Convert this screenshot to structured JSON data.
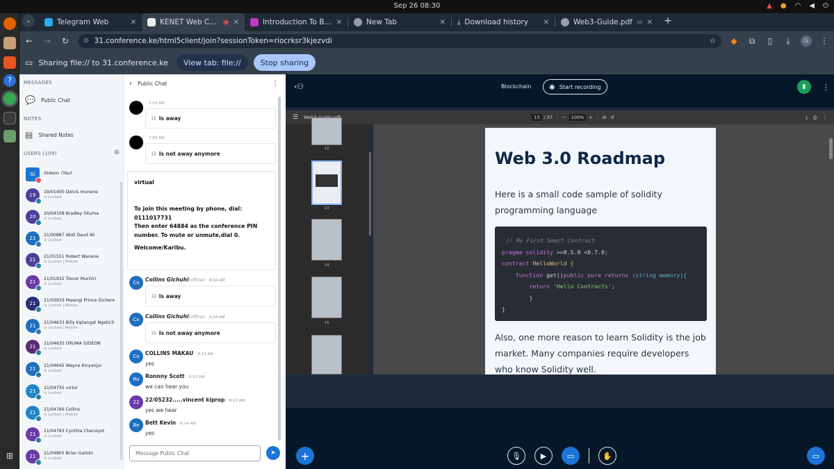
{
  "system": {
    "clock": "Sep 26  08:30"
  },
  "tabs": [
    {
      "label": "Telegram Web",
      "color": "#2aabee"
    },
    {
      "label": "KENET Web Conferenc",
      "color": "#eeeeee",
      "active": true
    },
    {
      "label": "Introduction To Blockcha",
      "color": "#c23bbd"
    },
    {
      "label": "New Tab",
      "color": "#9aa0a6"
    },
    {
      "label": "Download history",
      "color": "#9aa0a6"
    },
    {
      "label": "Web3-Guide.pdf",
      "color": "#9aa0a6"
    }
  ],
  "address": {
    "url": "31.conference.ke/html5client/join?sessionToken=riocrksr3kjezvdi"
  },
  "sharebar": {
    "text": "Sharing file:// to 31.conference.ke",
    "view_tab": "View tab: file://",
    "stop": "Stop sharing"
  },
  "sidebar": {
    "messages_head": "MESSAGES",
    "public_chat": "Public Chat",
    "notes_head": "NOTES",
    "shared_notes": "Shared Notes",
    "users_head": "USERS (109)",
    "users": [
      {
        "initials": "Gi",
        "name": "Gideon",
        "you": "(You)",
        "sub": "",
        "color": "#1b74d6"
      },
      {
        "initials": "19",
        "name": "19/01400 Delvis munene",
        "sub": "Locked",
        "color": "#4b3f9a"
      },
      {
        "initials": "20",
        "name": "20/04108 Bradley Situma",
        "sub": "Locked",
        "color": "#4b3f9a"
      },
      {
        "initials": "21",
        "name": "21/00887 Abdi Daud Ali",
        "sub": "Locked",
        "color": "#1f6fc0"
      },
      {
        "initials": "21",
        "name": "21/01551 Robert Wanene",
        "sub": "Locked | Mobile",
        "color": "#4b3f9a"
      },
      {
        "initials": "21",
        "name": "21/01932 Trevor Muchiri",
        "sub": "Locked",
        "color": "#6a3aa8"
      },
      {
        "initials": "21",
        "name": "21/03933 Mwangi Prince Gichere",
        "sub": "Locked | Mobile",
        "color": "#2a2f7a"
      },
      {
        "initials": "21",
        "name": "21/04633 Billy kiplangat Ngetich",
        "sub": "Locked | Mobile",
        "color": "#1f6fc0"
      },
      {
        "initials": "21",
        "name": "21/04635 ORUMA GIDEON",
        "sub": "Locked",
        "color": "#5b2a7a"
      },
      {
        "initials": "21",
        "name": "21/04645 Wayne Kinyanjui",
        "sub": "Locked",
        "color": "#1f6fc0"
      },
      {
        "initials": "21",
        "name": "21/04735 victor",
        "sub": "Locked",
        "color": "#1f86c8"
      },
      {
        "initials": "21",
        "name": "21/04766 Collins",
        "sub": "Locked | Mobile",
        "color": "#1f86c8"
      },
      {
        "initials": "21",
        "name": "21/04783 Cynthia Cheruiyot",
        "sub": "Locked",
        "color": "#6a3aa8"
      },
      {
        "initials": "21",
        "name": "21/04805 Brian Gatoto",
        "sub": "Locked",
        "color": "#6a3aa8"
      }
    ]
  },
  "chat": {
    "title": "Public Chat",
    "m1_time": "7:55 AM",
    "m1_text": "Is away",
    "m2_time": "7:55 AM",
    "m2_text": "Is not away anymore",
    "welcome": {
      "l1": "virtual",
      "l2": "To join this meeting by phone, dial:",
      "l3": "0111017731",
      "l4": "Then enter 64884 as the conference PIN number. To mute or unmute,dial 0.",
      "l5": "Welcome/Karibu."
    },
    "m3_name": "Collins Gichuhi",
    "m3_offline": "(offline)",
    "m3_time": "8:04 AM",
    "m3_text": "Is away",
    "m4_name": "Collins Gichuhi",
    "m4_offline": "(offline)",
    "m4_time": "8:04 AM",
    "m4_text": "Is not away anymore",
    "m5_name": "COLLINS MAKAU",
    "m5_time": "8:13 AM",
    "m5_text": "yes",
    "m6_name": "Ronnny Scott",
    "m6_time": "8:13 AM",
    "m6_text": "we can hear you",
    "m7_name": "22/05232.....vincent kiprop",
    "m7_time": "8:13 AM",
    "m7_text": "yes we hear",
    "m8_name": "Bett Kevin",
    "m8_time": "8:14 AM",
    "m8_text": "yes",
    "av_co": "Co",
    "av_ro": "Ro",
    "av_22": "22",
    "av_be": "Be",
    "placeholder": "Message Public Chat"
  },
  "meeting": {
    "title": "Blockchain",
    "record": "Start recording"
  },
  "pdf": {
    "name": "Web3-Guide.pdf",
    "page": "13",
    "pages": "/ 37",
    "zoom": "100%",
    "thumbs": [
      "12",
      "13",
      "14",
      "15"
    ]
  },
  "doc": {
    "heading": "Web 3.0 Roadmap",
    "intro": "Here is a small code sample of solidity programming language",
    "code": {
      "c1": "// My First Smart Contract",
      "c2a": "pragma solidity",
      "c2b": " >=0.5.0 <0.7.0;",
      "c3a": "contract",
      "c3b": " HelloWorld",
      "c3c": " {",
      "c4a": "function",
      "c4b": " get()",
      "c4c": "public pure returns",
      "c4d": " (string memory){",
      "c5a": "return",
      "c5b": " 'Hello Contracts'",
      "c6": "}",
      "c7": "}"
    },
    "outro": "Also, one more reason to learn Solidity is the job market. Many companies require developers who know Solidity well."
  }
}
